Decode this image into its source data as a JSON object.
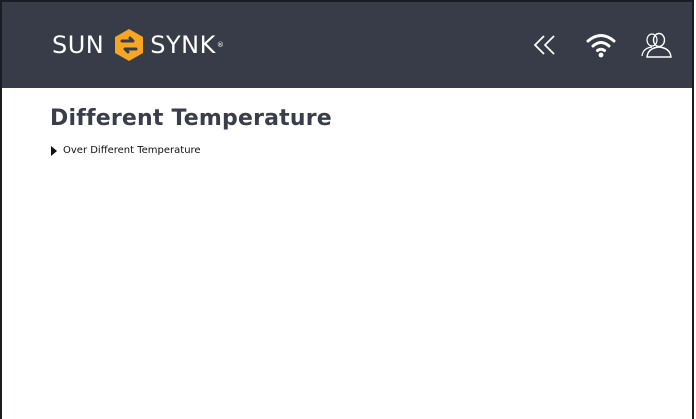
{
  "brand": {
    "left_text": "SUN",
    "right_text": "SYNK",
    "reg_mark": "®",
    "logo_color": "#f6a623"
  },
  "header": {
    "background": "#383c48",
    "icons": [
      "back-double-chevron-icon",
      "wifi-icon",
      "users-icon"
    ]
  },
  "page": {
    "title": "Different Temperature",
    "items": [
      {
        "label": "Over Different Temperature",
        "expanded": false
      }
    ]
  }
}
